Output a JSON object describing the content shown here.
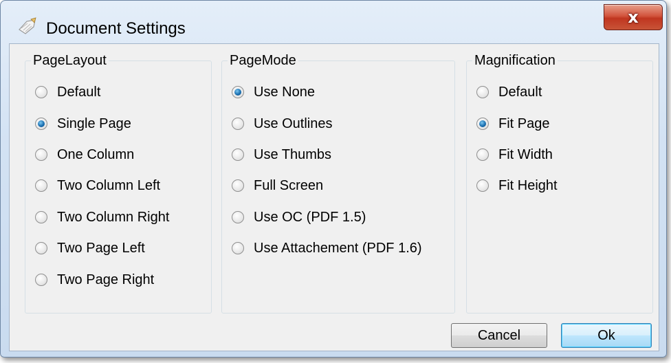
{
  "window": {
    "title": "Document Settings",
    "close_label": "x"
  },
  "groups": {
    "page_layout": {
      "legend": "PageLayout",
      "options": [
        "Default",
        "Single Page",
        "One Column",
        "Two Column Left",
        "Two Column Right",
        "Two Page Left",
        "Two Page Right"
      ],
      "selected": "Single Page"
    },
    "page_mode": {
      "legend": "PageMode",
      "options": [
        "Use None",
        "Use Outlines",
        "Use Thumbs",
        "Full Screen",
        "Use OC (PDF 1.5)",
        "Use Attachement (PDF 1.6)"
      ],
      "selected": "Use None"
    },
    "magnification": {
      "legend": "Magnification",
      "options": [
        "Default",
        "Fit Page",
        "Fit Width",
        "Fit Height"
      ],
      "selected": "Fit Page"
    }
  },
  "buttons": {
    "cancel": "Cancel",
    "ok": "Ok"
  },
  "colors": {
    "close_button": "#c84a32",
    "radio_checked": "#1a6fb0",
    "default_button_border": "#3c7fb1"
  },
  "icons": {
    "title": "document-settings-icon",
    "close": "close-icon"
  }
}
